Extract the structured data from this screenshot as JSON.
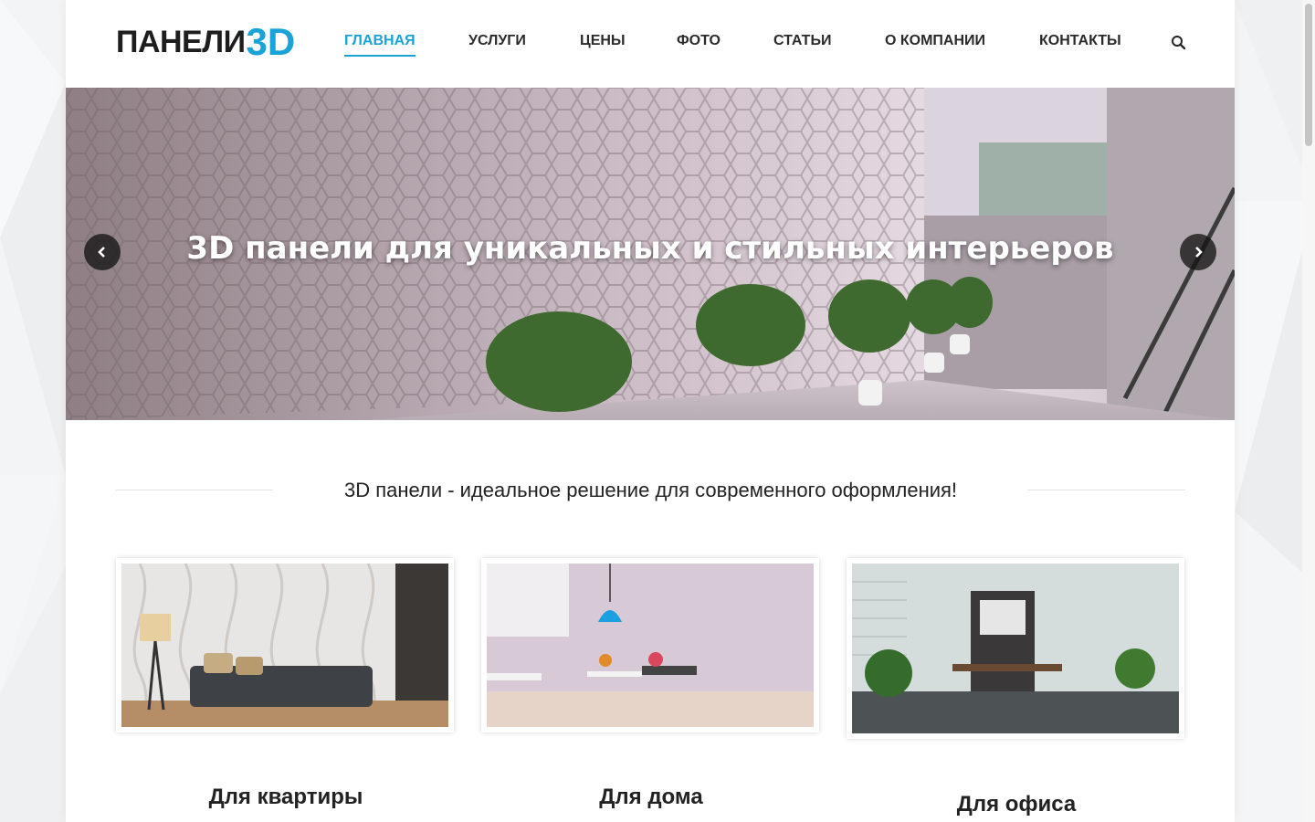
{
  "brand": {
    "name": "ПАНЕЛИ",
    "accent": "3D",
    "accent_color": "#1aa3d8"
  },
  "nav": {
    "items": [
      {
        "label": "ГЛАВНАЯ",
        "active": true
      },
      {
        "label": "УСЛУГИ",
        "active": false
      },
      {
        "label": "ЦЕНЫ",
        "active": false
      },
      {
        "label": "ФОТО",
        "active": false
      },
      {
        "label": "СТАТЬИ",
        "active": false
      },
      {
        "label": "О КОМПАНИИ",
        "active": false
      },
      {
        "label": "КОНТАКТЫ",
        "active": false
      }
    ],
    "search_icon": "search-icon"
  },
  "slider": {
    "caption": "3D панели для уникальных и стильных интерьеров",
    "prev_icon": "chevron-left-icon",
    "next_icon": "chevron-right-icon"
  },
  "section": {
    "title": "3D панели - идеальное решение для современного оформления!"
  },
  "cards": [
    {
      "title": "Для квартиры"
    },
    {
      "title": "Для дома"
    },
    {
      "title": "Для офиса"
    }
  ],
  "colors": {
    "accent": "#1aa3d8",
    "text": "#222222"
  }
}
